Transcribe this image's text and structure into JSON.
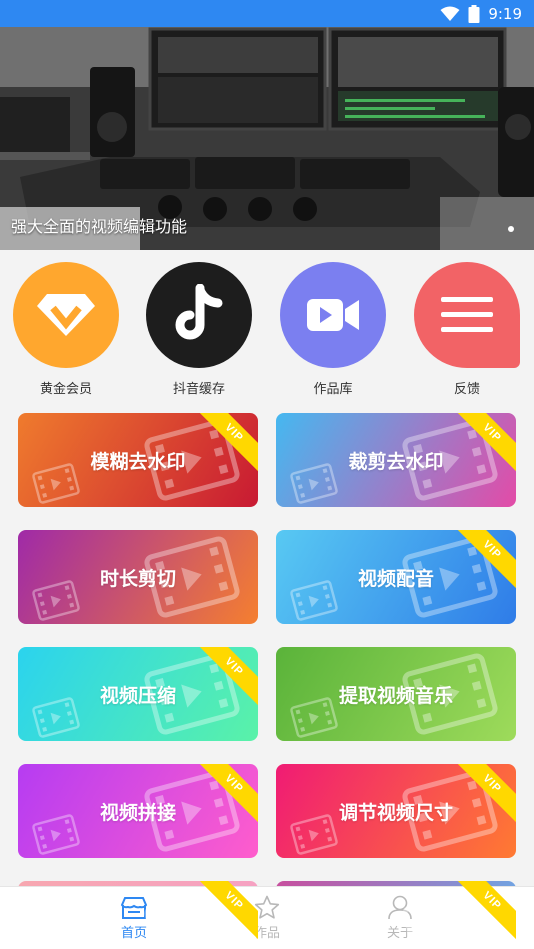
{
  "status_bar": {
    "time": "9:19"
  },
  "banner": {
    "caption": "强大全面的视频编辑功能"
  },
  "quick_actions": [
    {
      "label": "黄金会员",
      "icon": "vip-diamond-icon",
      "color": "#ffa72e"
    },
    {
      "label": "抖音缓存",
      "icon": "tiktok-icon",
      "color": "#1d1d1d"
    },
    {
      "label": "作品库",
      "icon": "video-camera-icon",
      "color": "#7b7ff0"
    },
    {
      "label": "反馈",
      "icon": "feedback-menu-icon",
      "color": "#f26366"
    }
  ],
  "tools": [
    {
      "title": "模糊去水印",
      "vip": true,
      "gradient": [
        "#ef7b2d",
        "#c81a33"
      ]
    },
    {
      "title": "裁剪去水印",
      "vip": true,
      "gradient": [
        "#45b8f0",
        "#e34ba7"
      ]
    },
    {
      "title": "时长剪切",
      "vip": false,
      "gradient": [
        "#9f2aa8",
        "#f57f2f"
      ]
    },
    {
      "title": "视频配音",
      "vip": true,
      "gradient": [
        "#58c9f3",
        "#2f7ce8"
      ]
    },
    {
      "title": "视频压缩",
      "vip": true,
      "gradient": [
        "#2bd3ee",
        "#5af2a8"
      ]
    },
    {
      "title": "提取视频音乐",
      "vip": false,
      "gradient": [
        "#5ab33a",
        "#9edb5b"
      ]
    },
    {
      "title": "视频拼接",
      "vip": true,
      "gradient": [
        "#b63cf2",
        "#ff5dcc"
      ]
    },
    {
      "title": "调节视频尺寸",
      "vip": true,
      "gradient": [
        "#f01b74",
        "#ff7a32"
      ]
    },
    {
      "title": "",
      "vip": true,
      "gradient": [
        "#f7a7b0",
        "#f6a0c6"
      ]
    },
    {
      "title": "",
      "vip": true,
      "gradient": [
        "#c84f9e",
        "#5fb5f0"
      ]
    }
  ],
  "tabs": [
    {
      "label": "首页",
      "icon": "shop-icon",
      "active": true
    },
    {
      "label": "作品",
      "icon": "star-icon",
      "active": false
    },
    {
      "label": "关于",
      "icon": "person-icon",
      "active": false
    }
  ],
  "colors": {
    "accent": "#2e88f2",
    "vip": "#ffd800"
  }
}
